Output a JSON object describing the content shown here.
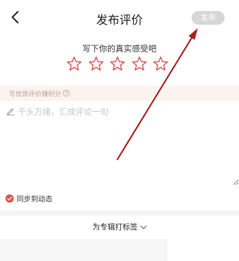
{
  "header": {
    "back_icon": "chevron-left-icon",
    "title": "发布评价",
    "publish_label": "发布"
  },
  "rating": {
    "prompt": "写下你的真实感受吧",
    "stars_total": 5,
    "stars_filled": 0,
    "star_icon": "star-outline-icon"
  },
  "tip": {
    "text": "写优质评价赚积分",
    "icon": "help-circle-icon"
  },
  "review": {
    "placeholder": "千头万绪，汇成评论一句",
    "value": "",
    "icon": "pencil-icon"
  },
  "sync": {
    "label": "同步到动态",
    "checked": true,
    "icon": "check-circle-icon"
  },
  "tags": {
    "label": "为专辑打标签",
    "icon": "chevron-down-icon"
  },
  "colors": {
    "accent": "#d9534f",
    "star_stroke": "#d54a4a",
    "annotation_arrow": "#a52020",
    "publish_disabled_bg": "#d6d6d6",
    "tip_bar_bg": "#fdf3ee"
  }
}
